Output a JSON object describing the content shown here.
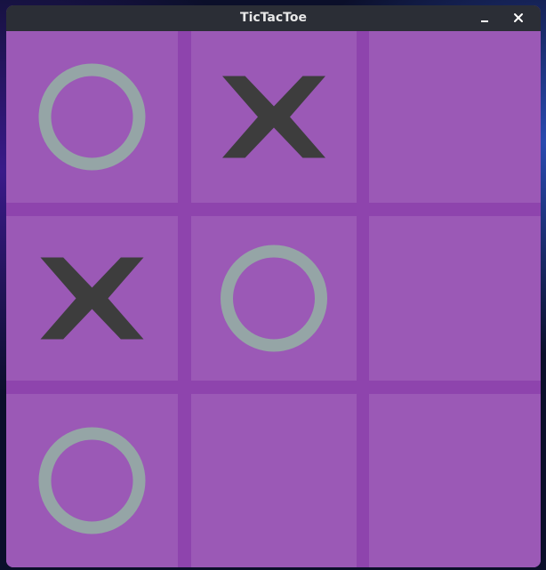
{
  "window": {
    "title": "TicTacToe",
    "minimize_icon": "minimize-icon",
    "close_icon": "close-icon"
  },
  "colors": {
    "board_lines": "#8e44ad",
    "cell": "#9b59b6",
    "x_mark": "#3d3d3d",
    "o_mark": "#95a5a6",
    "titlebar": "#2b2e36"
  },
  "board": {
    "cells": [
      [
        "O",
        "X",
        ""
      ],
      [
        "X",
        "O",
        ""
      ],
      [
        "O",
        "",
        ""
      ]
    ]
  }
}
